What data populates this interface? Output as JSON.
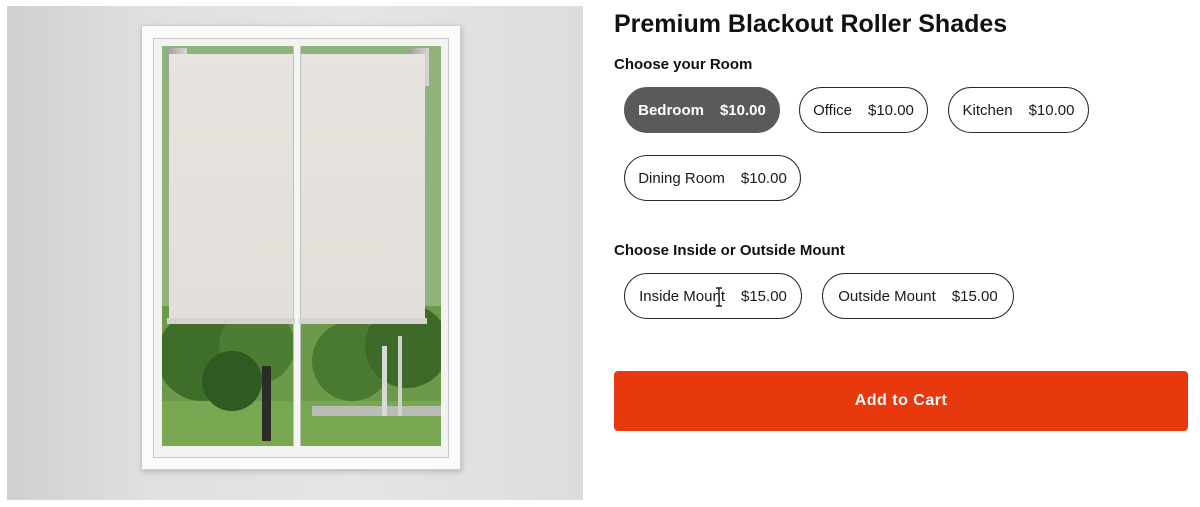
{
  "product": {
    "title": "Premium Blackout Roller Shades",
    "image_icon": "window-roller-shade-image"
  },
  "room": {
    "label": "Choose your Room",
    "options": [
      {
        "name": "Bedroom",
        "price": "$10.00",
        "selected": true
      },
      {
        "name": "Office",
        "price": "$10.00",
        "selected": false
      },
      {
        "name": "Kitchen",
        "price": "$10.00",
        "selected": false
      },
      {
        "name": "Dining Room",
        "price": "$10.00",
        "selected": false
      }
    ]
  },
  "mount": {
    "label": "Choose Inside or Outside Mount",
    "options": [
      {
        "name": "Inside Mount",
        "price": "$15.00",
        "selected": false
      },
      {
        "name": "Outside Mount",
        "price": "$15.00",
        "selected": false
      }
    ]
  },
  "cart": {
    "button_label": "Add to Cart"
  },
  "colors": {
    "accent": "#e8390e",
    "selected_pill": "#5a5a5a",
    "pill_border": "#2a2a2a"
  }
}
